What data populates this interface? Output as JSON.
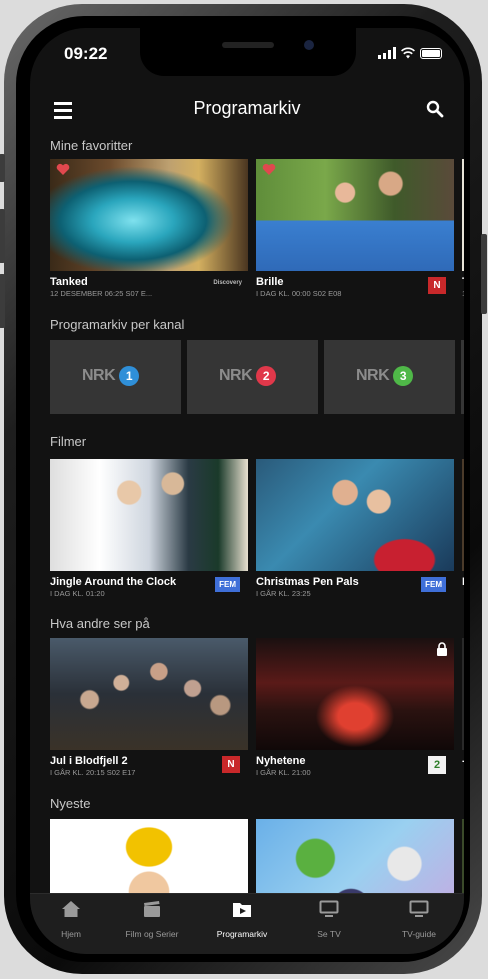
{
  "status_bar": {
    "time": "09:22"
  },
  "navbar": {
    "title": "Programarkiv"
  },
  "sections": {
    "favorites": {
      "title": "Mine favoritter",
      "cards": [
        {
          "title": "Tanked",
          "subtitle": "12 DESEMBER 06:25 S07 E...",
          "channel": "Discovery"
        },
        {
          "title": "Brille",
          "subtitle": "I DAG KL. 00:00 S02 E08",
          "channel": "N"
        },
        {
          "title": "T",
          "subtitle": "1"
        }
      ]
    },
    "channels": {
      "title": "Programarkiv per kanal",
      "items": [
        {
          "brand": "NRK",
          "number": "1",
          "color": "#2f8fd8"
        },
        {
          "brand": "NRK",
          "number": "2",
          "color": "#e0384a"
        },
        {
          "brand": "NRK",
          "number": "3",
          "color": "#4fb848"
        }
      ]
    },
    "films": {
      "title": "Filmer",
      "cards": [
        {
          "title": "Jingle Around the Clock",
          "subtitle": "I DAG KL. 01:20",
          "channel": "FEM"
        },
        {
          "title": "Christmas Pen Pals",
          "subtitle": "I GÅR KL. 23:25",
          "channel": "FEM"
        },
        {
          "title": "L",
          "subtitle": ""
        }
      ]
    },
    "others": {
      "title": "Hva andre ser på",
      "cards": [
        {
          "title": "Jul i Blodfjell 2",
          "subtitle": "I GÅR KL. 20:15 S02 E17",
          "channel": "N"
        },
        {
          "title": "Nyhetene",
          "subtitle": "I GÅR KL. 21:00",
          "channel": "2"
        },
        {
          "title": "-",
          "subtitle": ""
        }
      ]
    },
    "newest": {
      "title": "Nyeste"
    }
  },
  "tabs": [
    {
      "label": "Hjem"
    },
    {
      "label": "Film og Serier"
    },
    {
      "label": "Programarkiv"
    },
    {
      "label": "Se TV"
    },
    {
      "label": "TV-guide"
    }
  ],
  "active_tab": "Programarkiv",
  "icons": [
    "menu-icon",
    "search-icon",
    "heart-icon",
    "lock-icon",
    "home-icon",
    "clapperboard-icon",
    "play-folder-icon",
    "tv-icon"
  ],
  "colors": {
    "background": "#121212",
    "tile": "#353535",
    "nrk_red": "#c8282a",
    "fem_blue": "#3f6fd8",
    "tv2_green": "#2f7f2a"
  }
}
